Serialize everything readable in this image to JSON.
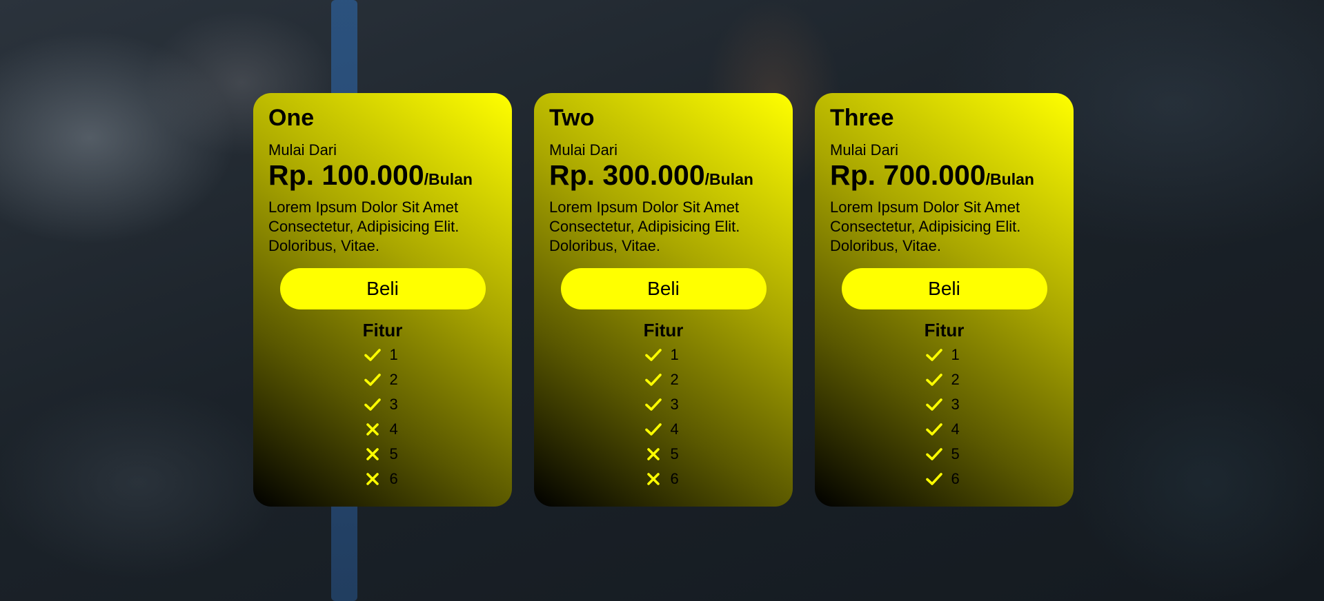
{
  "plans": [
    {
      "name": "One",
      "from_label": "Mulai Dari",
      "price": "Rp. 100.000",
      "period": "/Bulan",
      "description": "Lorem Ipsum Dolor Sit Amet Consectetur, Adipisicing Elit. Doloribus, Vitae.",
      "button_label": "Beli",
      "features_title": "Fitur",
      "features": [
        {
          "label": "1",
          "included": true,
          "icon": "check-icon"
        },
        {
          "label": "2",
          "included": true,
          "icon": "check-icon"
        },
        {
          "label": "3",
          "included": true,
          "icon": "check-icon"
        },
        {
          "label": "4",
          "included": false,
          "icon": "x-icon"
        },
        {
          "label": "5",
          "included": false,
          "icon": "x-icon"
        },
        {
          "label": "6",
          "included": false,
          "icon": "x-icon"
        }
      ]
    },
    {
      "name": "Two",
      "from_label": "Mulai Dari",
      "price": "Rp. 300.000",
      "period": "/Bulan",
      "description": "Lorem Ipsum Dolor Sit Amet Consectetur, Adipisicing Elit. Doloribus, Vitae.",
      "button_label": "Beli",
      "features_title": "Fitur",
      "features": [
        {
          "label": "1",
          "included": true,
          "icon": "check-icon"
        },
        {
          "label": "2",
          "included": true,
          "icon": "check-icon"
        },
        {
          "label": "3",
          "included": true,
          "icon": "check-icon"
        },
        {
          "label": "4",
          "included": true,
          "icon": "check-icon"
        },
        {
          "label": "5",
          "included": false,
          "icon": "x-icon"
        },
        {
          "label": "6",
          "included": false,
          "icon": "x-icon"
        }
      ]
    },
    {
      "name": "Three",
      "from_label": "Mulai Dari",
      "price": "Rp. 700.000",
      "period": "/Bulan",
      "description": "Lorem Ipsum Dolor Sit Amet Consectetur, Adipisicing Elit. Doloribus, Vitae.",
      "button_label": "Beli",
      "features_title": "Fitur",
      "features": [
        {
          "label": "1",
          "included": true,
          "icon": "check-icon"
        },
        {
          "label": "2",
          "included": true,
          "icon": "check-icon"
        },
        {
          "label": "3",
          "included": true,
          "icon": "check-icon"
        },
        {
          "label": "4",
          "included": true,
          "icon": "check-icon"
        },
        {
          "label": "5",
          "included": true,
          "icon": "check-icon"
        },
        {
          "label": "6",
          "included": true,
          "icon": "check-icon"
        }
      ]
    }
  ],
  "colors": {
    "accent": "#ffff00",
    "icon": "#ffff00",
    "text": "#000000"
  }
}
